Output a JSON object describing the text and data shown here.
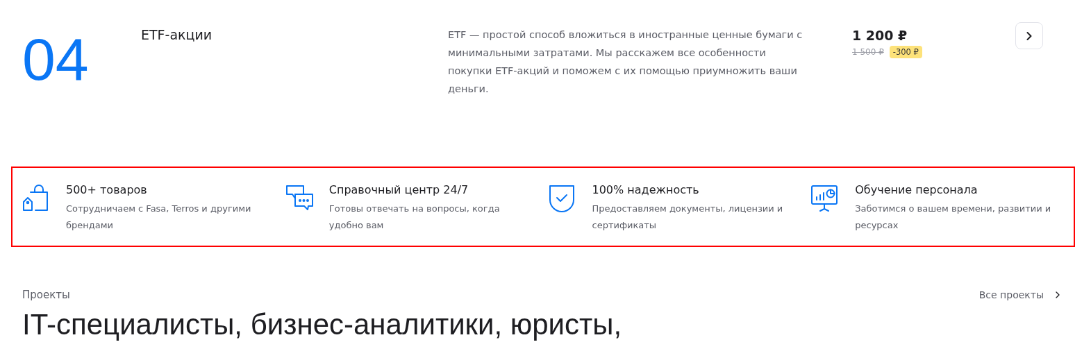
{
  "course": {
    "number": "04",
    "title": "ETF-акции",
    "description": "ETF — простой способ вложиться в иностранные ценные бумаги с минимальными затратами. Мы расскажем все особенности покупки ETF-акций и поможем с их помощью приумножить ваши деньги.",
    "price": "1 200 ₽",
    "old_price": "1 500 ₽",
    "discount": "-300 ₽"
  },
  "features": {
    "highlighted": true,
    "items": [
      {
        "kind": "bag",
        "title": "500+ товаров",
        "text": "Сотрудничаем с Fasa, Terros и другими брендами"
      },
      {
        "kind": "chat",
        "title": "Справочный центр 24/7",
        "text": "Готовы отвечать на вопросы, когда удобно вам"
      },
      {
        "kind": "shield",
        "title": "100% надежность",
        "text": "Предоставляем документы, лицензии и сертификаты"
      },
      {
        "kind": "board",
        "title": "Обучение персонала",
        "text": "Заботимся о вашем времени, развитии и ресурсах"
      }
    ]
  },
  "projects": {
    "label": "Проекты",
    "all_link": "Все проекты",
    "heading": "IT-специалисты, бизнес-аналитики, юристы,"
  }
}
